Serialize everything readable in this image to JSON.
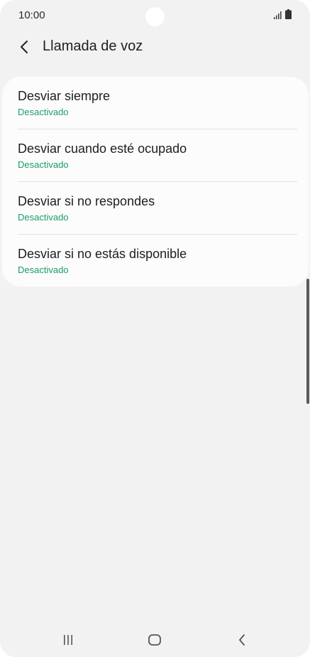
{
  "status_bar": {
    "time": "10:00",
    "icons": [
      "signal-icon",
      "battery-icon"
    ]
  },
  "header": {
    "title": "Llamada de voz",
    "back_icon": "chevron-left-icon"
  },
  "forwarding_options": [
    {
      "title": "Desviar siempre",
      "status": "Desactivado"
    },
    {
      "title": "Desviar cuando esté ocupado",
      "status": "Desactivado"
    },
    {
      "title": "Desviar si no respondes",
      "status": "Desactivado"
    },
    {
      "title": "Desviar si no estás disponible",
      "status": "Desactivado"
    }
  ],
  "nav_bar": {
    "icons": [
      "recent-apps-icon",
      "home-icon",
      "back-icon"
    ]
  },
  "colors": {
    "background": "#f2f2f2",
    "card": "#fcfcfc",
    "status_text": "#1a9e67",
    "primary_text": "#1e1e1e"
  }
}
